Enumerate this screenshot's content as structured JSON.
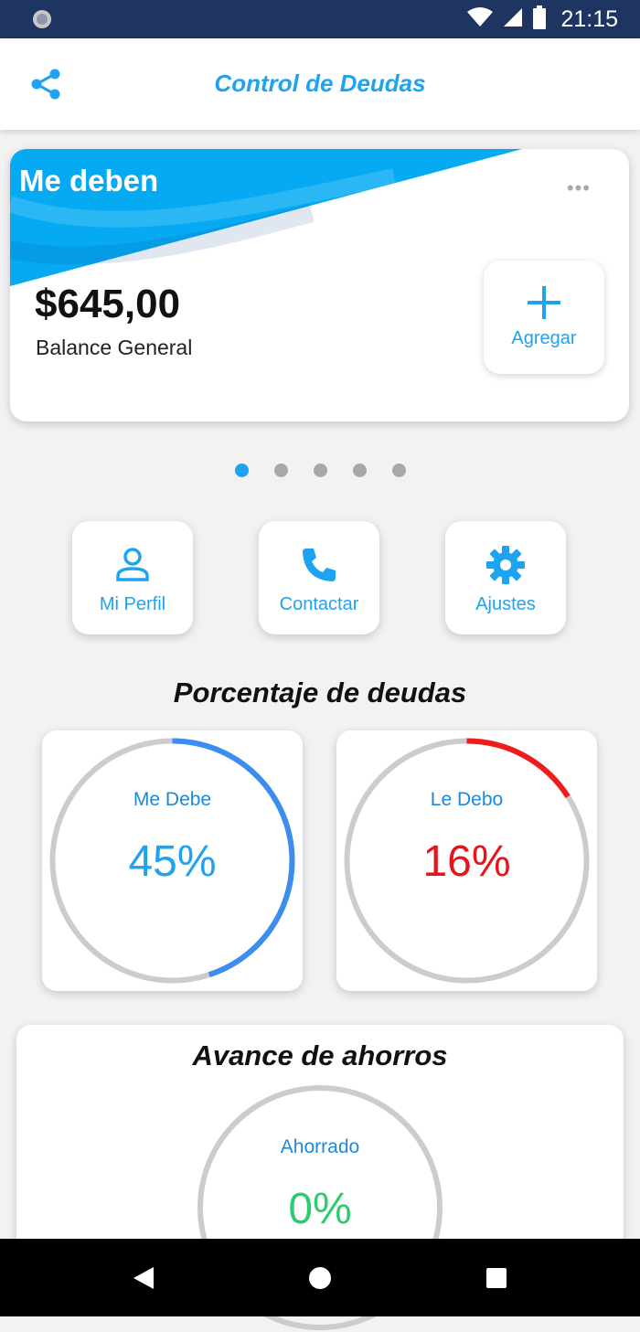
{
  "status_bar": {
    "time": "21:15"
  },
  "app_bar": {
    "title": "Control de Deudas"
  },
  "balance_card": {
    "heading": "Me deben",
    "more": "•••",
    "amount": "$645,00",
    "amount_label": "Balance General",
    "add_label": "Agregar"
  },
  "pager": {
    "count": 5,
    "active_index": 0
  },
  "quick_actions": [
    {
      "label": "Mi Perfil",
      "icon": "person-icon"
    },
    {
      "label": "Contactar",
      "icon": "phone-icon"
    },
    {
      "label": "Ajustes",
      "icon": "gear-icon"
    }
  ],
  "debts_section": {
    "title": "Porcentaje de deudas"
  },
  "gauges": [
    {
      "label": "Me Debe",
      "value_text": "45%",
      "percent": 45,
      "color": "#3b8df0",
      "text_color": "#1ea3f0"
    },
    {
      "label": "Le Debo",
      "value_text": "16%",
      "percent": 16,
      "color": "#ef1c1c",
      "text_color": "#e8141c"
    }
  ],
  "savings": {
    "title": "Avance de ahorros",
    "label": "Ahorrado",
    "value_text": "0%",
    "percent": 0,
    "color": "#2ecc71"
  },
  "colors": {
    "accent": "#1ea3f0",
    "status_bar": "#1e3461",
    "track": "#cccccc"
  }
}
